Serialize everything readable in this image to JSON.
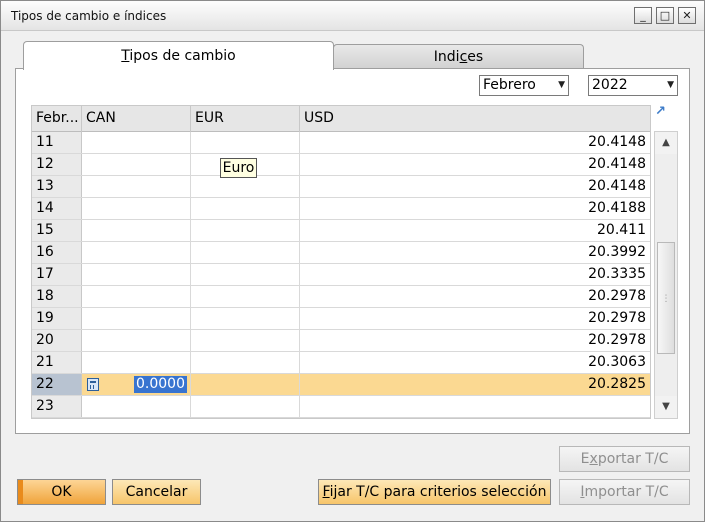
{
  "window": {
    "title": "Tipos de cambio e índices",
    "controls": {
      "minimize": "_",
      "maximize": "□",
      "close": "✕"
    }
  },
  "tabs": [
    {
      "label": "Tipos de cambio",
      "accel": "T",
      "rest": "ipos de cambio",
      "active": true
    },
    {
      "label": "Indices",
      "pre": "Indi",
      "accel": "c",
      "rest": "es",
      "active": false
    }
  ],
  "filters": {
    "month": "Febrero",
    "year": "2022"
  },
  "grid": {
    "columns": [
      "Febr...",
      "CAN",
      "EUR",
      "USD"
    ],
    "rows": [
      {
        "day": "11",
        "can": "",
        "eur": "",
        "usd": "20.4148"
      },
      {
        "day": "12",
        "can": "",
        "eur": "",
        "usd": "20.4148"
      },
      {
        "day": "13",
        "can": "",
        "eur": "",
        "usd": "20.4148"
      },
      {
        "day": "14",
        "can": "",
        "eur": "",
        "usd": "20.4188"
      },
      {
        "day": "15",
        "can": "",
        "eur": "",
        "usd": "20.411"
      },
      {
        "day": "16",
        "can": "",
        "eur": "",
        "usd": "20.3992"
      },
      {
        "day": "17",
        "can": "",
        "eur": "",
        "usd": "20.3335"
      },
      {
        "day": "18",
        "can": "",
        "eur": "",
        "usd": "20.2978"
      },
      {
        "day": "19",
        "can": "",
        "eur": "",
        "usd": "20.2978"
      },
      {
        "day": "20",
        "can": "",
        "eur": "",
        "usd": "20.2978"
      },
      {
        "day": "21",
        "can": "",
        "eur": "",
        "usd": "20.3063"
      },
      {
        "day": "22",
        "can": "0.0000",
        "eur": "",
        "usd": "20.2825",
        "selected": true
      },
      {
        "day": "23",
        "can": "",
        "eur": "",
        "usd": ""
      }
    ],
    "tooltip": "Euro"
  },
  "buttons": {
    "ok": "OK",
    "cancel": "Cancelar",
    "fijar": {
      "accel": "F",
      "rest": "ijar T/C para criterios selección"
    },
    "exportar": {
      "pre": "E",
      "accel": "x",
      "rest": "portar T/C"
    },
    "importar": {
      "accel": "I",
      "rest": "mportar T/C"
    }
  },
  "colors": {
    "selected_row": "#fbd992",
    "accent_orange": "#f0a43b",
    "edit_highlight": "#3874d0"
  }
}
